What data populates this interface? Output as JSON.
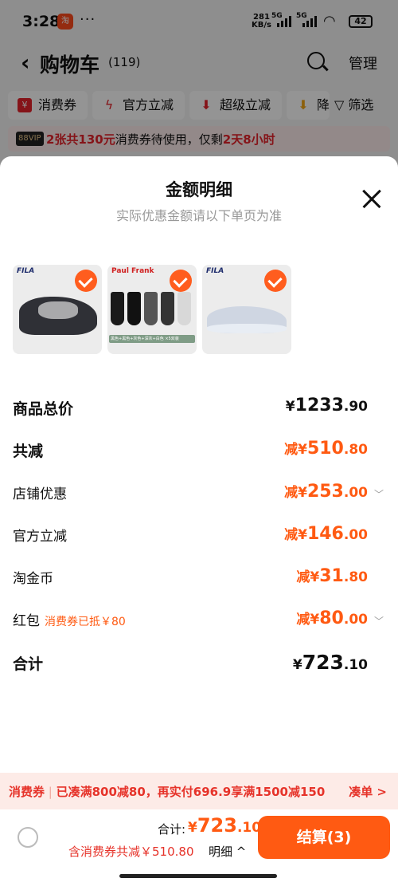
{
  "status_bar": {
    "time": "3:28",
    "net_speed_value": "281",
    "net_speed_unit": "KB/s",
    "signal_1": "5G",
    "signal_2": "5G",
    "battery": "42"
  },
  "header": {
    "back_icon": "chevron-left-icon",
    "title": "购物车",
    "count": "(119)",
    "search_icon": "search-icon",
    "manage_label": "管理"
  },
  "filter_chips": [
    {
      "label": "消费券",
      "icon": "coupon-icon"
    },
    {
      "label": "官方立减",
      "icon": "lightning-icon"
    },
    {
      "label": "超级立减",
      "icon": "down-arrow-icon"
    },
    {
      "label": "降",
      "icon": "price-drop-icon"
    }
  ],
  "filter_button": {
    "icon": "filter-icon",
    "label": "筛选"
  },
  "banner": {
    "badge": "88VIP",
    "text_highlight": "2张共130元",
    "text_middle": "消费券待使用，仅剩",
    "text_time": "2天8小时"
  },
  "sheet": {
    "title": "金额明细",
    "subtitle": "实际优惠金额请以下单页为准",
    "close_icon": "close-icon",
    "products": [
      {
        "brand": "FILA",
        "checked": true
      },
      {
        "brand": "Paul Frank",
        "checked": true,
        "caption": "黑色+黑色+灰色+深灰+白色 ×5双装"
      },
      {
        "brand": "FILA",
        "checked": true
      }
    ],
    "rows": [
      {
        "label": "商品总价",
        "prefix": "¥",
        "int": "1233",
        "dec": ".90",
        "style": "normal-bold"
      },
      {
        "label": "共减",
        "prefix": "减¥",
        "int": "510",
        "dec": ".80",
        "style": "orange-bold"
      },
      {
        "label": "店铺优惠",
        "prefix": "减¥",
        "int": "253",
        "dec": ".00",
        "style": "orange",
        "chevron": "chevron-down-icon"
      },
      {
        "label": "官方立减",
        "prefix": "减¥",
        "int": "146",
        "dec": ".00",
        "style": "orange"
      },
      {
        "label": "淘金币",
        "prefix": "减¥",
        "int": "31",
        "dec": ".80",
        "style": "orange"
      },
      {
        "label": "红包",
        "note": "消费券已抵￥80",
        "prefix": "减¥",
        "int": "80",
        "dec": ".00",
        "style": "orange",
        "chevron": "chevron-down-icon"
      },
      {
        "label": "合计",
        "prefix": "¥",
        "int": "723",
        "dec": ".10",
        "style": "total"
      }
    ]
  },
  "promo_bar": {
    "tag": "消费券",
    "text": "已凑满800减80，再实付696.9享满1500减150",
    "link": "凑单 >"
  },
  "bottom_bar": {
    "total_label": "合计:",
    "total_prefix": "¥",
    "total_int": "723",
    "total_dec": ".10",
    "discount_note": "含消费券共减￥510.80",
    "detail_label": "明细 ^",
    "checkout_label": "结算(3)"
  },
  "colors": {
    "accent": "#ff5a12",
    "red": "#e6332a",
    "check": "#ff5d1e"
  }
}
